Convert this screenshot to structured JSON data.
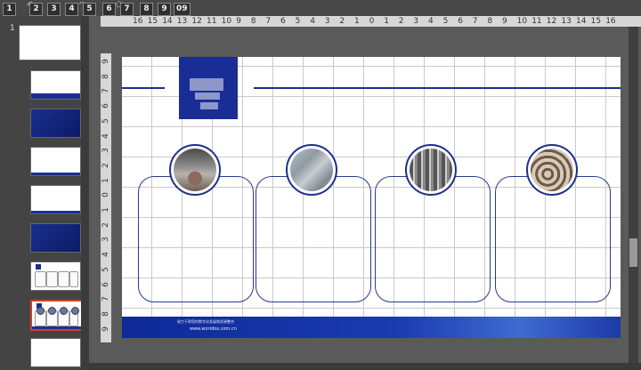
{
  "toolbar": {
    "keytips": [
      "1",
      "2",
      "3",
      "4",
      "5",
      "6",
      "7",
      "8",
      "9",
      "09"
    ]
  },
  "thumbnails": {
    "first_number": "1",
    "count": 9,
    "selected_index": 8
  },
  "rulers": {
    "horizontal_labels": [
      "16",
      "15",
      "14",
      "13",
      "12",
      "11",
      "10",
      "9",
      "8",
      "7",
      "6",
      "5",
      "4",
      "3",
      "2",
      "1",
      "0",
      "1",
      "2",
      "3",
      "4",
      "5",
      "6",
      "7",
      "8",
      "9",
      "10",
      "11",
      "12",
      "13",
      "14",
      "15",
      "16"
    ],
    "vertical_labels": [
      "9",
      "8",
      "7",
      "6",
      "5",
      "4",
      "3",
      "2",
      "1",
      "0",
      "1",
      "2",
      "3",
      "4",
      "5",
      "6",
      "7",
      "8",
      "9"
    ]
  },
  "slide": {
    "footer_line1": "致力于帮您的数字化发展和资源整合",
    "footer_line2": "www.worldox.com.cn"
  },
  "colors": {
    "brand_blue": "#1a2d97",
    "selection_red": "#c8442c"
  }
}
